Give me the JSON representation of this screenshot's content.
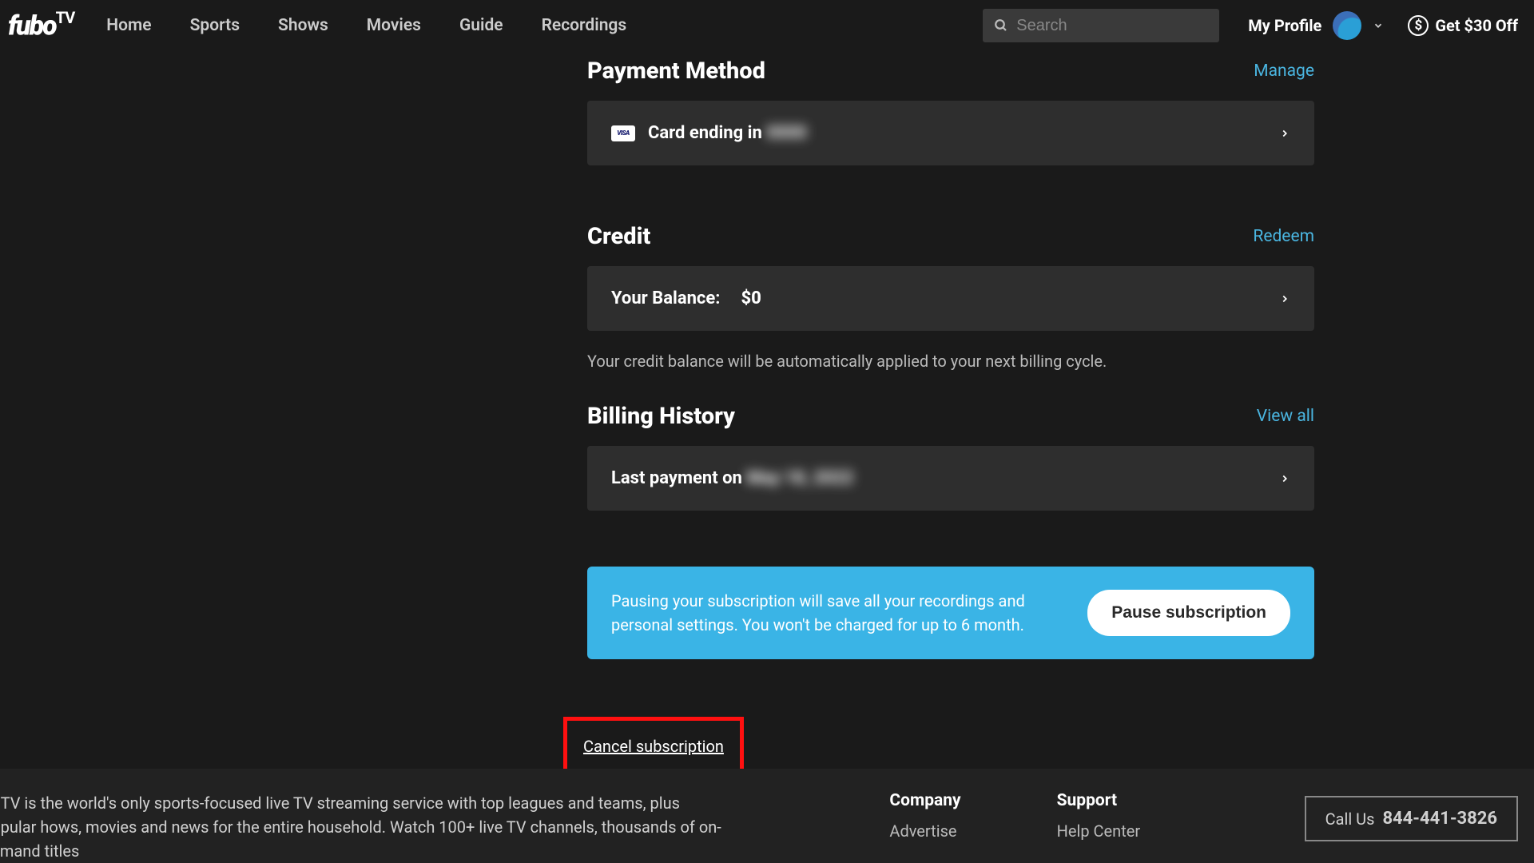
{
  "brand": "fubo",
  "brandSuffix": "TV",
  "nav": {
    "home": "Home",
    "sports": "Sports",
    "shows": "Shows",
    "movies": "Movies",
    "guide": "Guide",
    "recordings": "Recordings"
  },
  "search": {
    "placeholder": "Search"
  },
  "profile": {
    "label": "My Profile"
  },
  "promo": {
    "text": "Get $30 Off",
    "symbol": "$"
  },
  "payment": {
    "title": "Payment Method",
    "manage": "Manage",
    "cardText": "Card ending in",
    "cardMasked": "0000",
    "visa": "VISA"
  },
  "credit": {
    "title": "Credit",
    "redeem": "Redeem",
    "balanceLabel": "Your Balance:",
    "balanceValue": "$0",
    "helper": "Your credit balance will be automatically applied to your next billing cycle."
  },
  "billing": {
    "title": "Billing History",
    "viewAll": "View all",
    "lastPaymentLabel": "Last payment on",
    "lastPaymentDate": "May 18, 2022"
  },
  "pause": {
    "text": "Pausing your subscription will save all your recordings and personal settings. You won't be charged for up to 6 month.",
    "button": "Pause subscription"
  },
  "cancel": {
    "label": "Cancel subscription"
  },
  "footer": {
    "desc": "boTV is the world's only sports-focused live TV streaming service with top leagues and teams, plus popular hows, movies and news for the entire household. Watch 100+ live TV channels, thousands of on-demand titles",
    "companyTitle": "Company",
    "advertise": "Advertise",
    "supportTitle": "Support",
    "helpCenter": "Help Center",
    "callLabel": "Call Us",
    "callNumber": "844-441-3826"
  }
}
